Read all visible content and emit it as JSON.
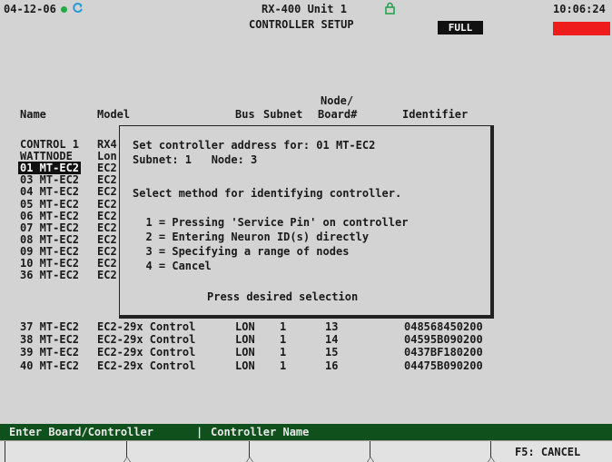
{
  "header": {
    "date": "04-12-06",
    "title": "RX-400 Unit 1",
    "subtitle": "CONTROLLER SETUP",
    "mode_badge": "FULL",
    "time": "10:06:24",
    "status_dot_color": "#22aa44",
    "alarm_color": "#ee1c1c",
    "icons": [
      "status-dot",
      "refresh-icon",
      "lock-icon"
    ]
  },
  "table": {
    "header_line1": "Node/",
    "columns": [
      "Name",
      "Model",
      "Bus",
      "Subnet",
      "Board#",
      "Identifier"
    ],
    "rows_partial": [
      {
        "name": "CONTROL 1",
        "model": "RX4"
      },
      {
        "name": "WATTNODE",
        "model": "Lon"
      },
      {
        "name": "01 MT-EC2",
        "model": "EC2",
        "selected": true
      },
      {
        "name": "03 MT-EC2",
        "model": "EC2"
      },
      {
        "name": "04 MT-EC2",
        "model": "EC2"
      },
      {
        "name": "05 MT-EC2",
        "model": "EC2"
      },
      {
        "name": "06 MT-EC2",
        "model": "EC2"
      },
      {
        "name": "07 MT-EC2",
        "model": "EC2"
      },
      {
        "name": "08 MT-EC2",
        "model": "EC2"
      },
      {
        "name": "09 MT-EC2",
        "model": "EC2"
      },
      {
        "name": "10 MT-EC2",
        "model": "EC2"
      },
      {
        "name": "36 MT-EC2",
        "model": "EC2"
      }
    ],
    "rows_full": [
      {
        "name": "37 MT-EC2",
        "model": "EC2-29x Control",
        "bus": "LON",
        "subnet": "1",
        "node": "13",
        "id": "048568450200"
      },
      {
        "name": "38 MT-EC2",
        "model": "EC2-29x Control",
        "bus": "LON",
        "subnet": "1",
        "node": "14",
        "id": "04595B090200"
      },
      {
        "name": "39 MT-EC2",
        "model": "EC2-29x Control",
        "bus": "LON",
        "subnet": "1",
        "node": "15",
        "id": "0437BF180200"
      },
      {
        "name": "40 MT-EC2",
        "model": "EC2-29x Control",
        "bus": "LON",
        "subnet": "1",
        "node": "16",
        "id": "04475B090200"
      }
    ]
  },
  "dialog": {
    "line1": "Set controller address for: 01 MT-EC2",
    "line2": "Subnet: 1   Node: 3",
    "prompt": "Select method for identifying controller.",
    "options": [
      "  1 = Pressing 'Service Pin' on controller",
      "  2 = Entering Neuron ID(s) directly",
      "  3 = Specifying a range of nodes",
      "  4 = Cancel"
    ],
    "footer": "Press desired selection"
  },
  "statusbar": {
    "left": "Enter Board/Controller",
    "separator": "|",
    "right": "Controller Name"
  },
  "fkeys": [
    "",
    "",
    "",
    "",
    "F5: CANCEL"
  ]
}
